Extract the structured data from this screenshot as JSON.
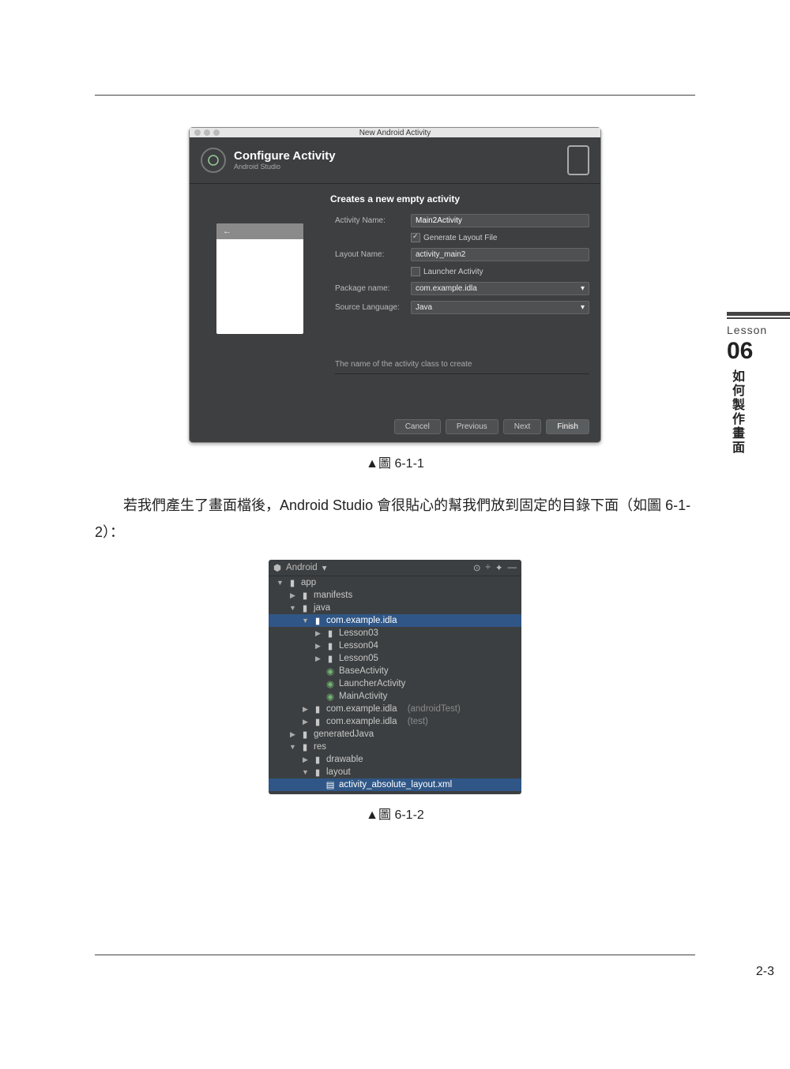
{
  "sidebar": {
    "lesson_label": "Lesson",
    "lesson_num": "06",
    "vtext": "如何製作畫面"
  },
  "dialog": {
    "window_title": "New Android Activity",
    "title": "Configure Activity",
    "subtitle": "Android Studio",
    "section_heading": "Creates a new empty activity",
    "back_arrow": "←",
    "fields": {
      "activity_name_label": "Activity Name:",
      "activity_name": "Main2Activity",
      "gen_layout_label": "Generate Layout File",
      "layout_name_label": "Layout Name:",
      "layout_name": "activity_main2",
      "launcher_label": "Launcher Activity",
      "package_label": "Package name:",
      "package": "com.example.idla",
      "lang_label": "Source Language:",
      "lang": "Java"
    },
    "hint": "The name of the activity class to create",
    "buttons": {
      "cancel": "Cancel",
      "previous": "Previous",
      "next": "Next",
      "finish": "Finish"
    }
  },
  "caption1": "▲圖 6-1-1",
  "paragraph": "若我們產生了畫面檔後，Android Studio 會很貼心的幫我們放到固定的目錄下面（如圖 6-1-2）：",
  "tree": {
    "header": "Android",
    "nodes": {
      "app": "app",
      "manifests": "manifests",
      "java": "java",
      "pkg1": "com.example.idla",
      "lesson03": "Lesson03",
      "lesson04": "Lesson04",
      "lesson05": "Lesson05",
      "base": "BaseActivity",
      "launcher": "LauncherActivity",
      "main": "MainActivity",
      "pkg_at": "com.example.idla",
      "pkg_at_suffix": "(androidTest)",
      "pkg_test": "com.example.idla",
      "pkg_test_suffix": "(test)",
      "gen": "generatedJava",
      "res": "res",
      "drawable": "drawable",
      "layout": "layout",
      "xml": "activity_absolute_layout.xml"
    }
  },
  "caption2": "▲圖 6-1-2",
  "page_number": "2-3"
}
